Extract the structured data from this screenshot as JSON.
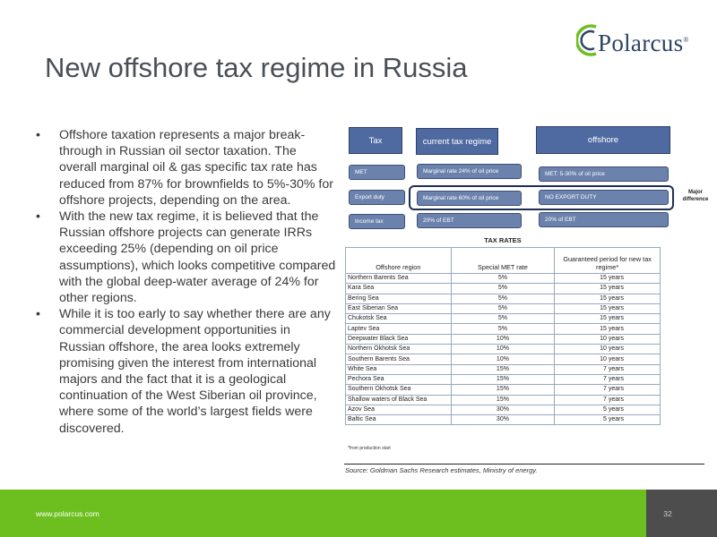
{
  "logo": {
    "text": "Polarcus",
    "mark": "®"
  },
  "title": "New offshore tax regime in Russia",
  "bullets": [
    "Offshore taxation represents a major break-through in Russian oil sector taxation. The overall marginal oil & gas specific tax rate has reduced from 87% for brownfields to 5%-30% for offshore projects, depending on the area.",
    "With the new tax regime, it is believed that the Russian offshore projects can generate IRRs exceeding 25% (depending on oil price assumptions), which looks competitive compared with the global deep-water average of 24% for other regions.",
    "While it is too early to say whether there are any commercial development opportunities in Russian offshore, the area looks extremely promising given the interest from international majors and the fact that it is a geological continuation of the West Siberian oil province, where some of the world’s largest fields were discovered."
  ],
  "diagram": {
    "headers": {
      "tax": "Tax",
      "current": "current tax regime",
      "offshore": "offshore"
    },
    "rows": [
      {
        "label": "MET",
        "current": "Marginal rate 24% of oil price",
        "offshore": "MET:  5-30% of oil price"
      },
      {
        "label": "Export duty",
        "current": "Marginal rate 60% of oil price",
        "offshore": "NO EXPORT DUTY"
      },
      {
        "label": "Income tax",
        "current": "20% of EBT",
        "offshore": "20% of EBT"
      }
    ],
    "major_difference": "Major difference",
    "colors": {
      "box": "#6b82ad",
      "header": "#4f6aa0",
      "border": "#1e3050"
    }
  },
  "table": {
    "title": "TAX RATES",
    "headers": [
      "Offshore region",
      "Special MET rate",
      "Guaranteed period for new tax regime*"
    ],
    "rows": [
      [
        "Northern Barents Sea",
        "5%",
        "15 years"
      ],
      [
        "Kara Sea",
        "5%",
        "15 years"
      ],
      [
        "Bering Sea",
        "5%",
        "15 years"
      ],
      [
        "East Siberian Sea",
        "5%",
        "15 years"
      ],
      [
        "Chukotsk Sea",
        "5%",
        "15 years"
      ],
      [
        "Laptev Sea",
        "5%",
        "15 years"
      ],
      [
        "Deepwater Black Sea",
        "10%",
        "10 years"
      ],
      [
        "Northern Okhotsk Sea",
        "10%",
        "10 years"
      ],
      [
        "Southern Barents Sea",
        "10%",
        "10 years"
      ],
      [
        "White Sea",
        "15%",
        "7 years"
      ],
      [
        "Pechora Sea",
        "15%",
        "7 years"
      ],
      [
        "Southern Okhotsk Sea",
        "15%",
        "7 years"
      ],
      [
        "Shallow waters of Black Sea",
        "15%",
        "7 years"
      ],
      [
        "Azov Sea",
        "30%",
        "5 years"
      ],
      [
        "Baltic Sea",
        "30%",
        "5 years"
      ]
    ],
    "footnote": "*from production start"
  },
  "source": "Source: Goldman Sachs Research estimates, Ministry of energy.",
  "footer": {
    "url": "www.polarcus.com",
    "page": "32",
    "colors": {
      "bar": "#6cbf1e",
      "page_box": "#4d4d4d"
    }
  }
}
